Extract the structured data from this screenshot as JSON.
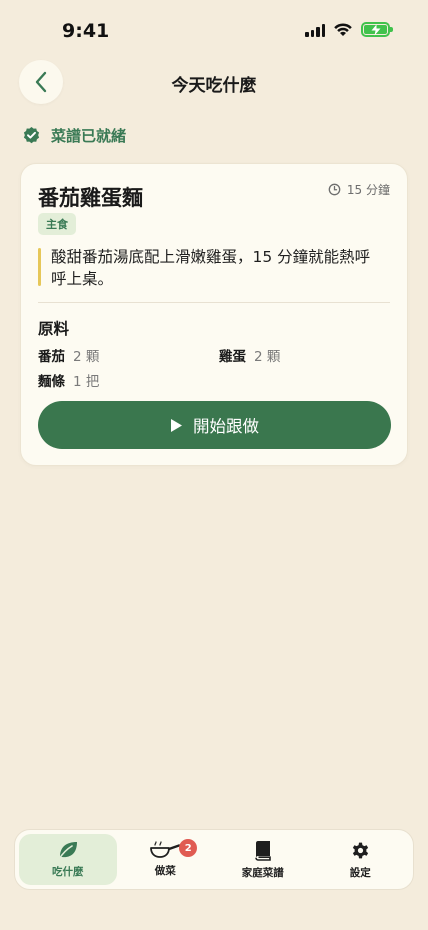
{
  "status_bar": {
    "time": "9:41"
  },
  "header": {
    "title": "今天吃什麼"
  },
  "status": {
    "label": "菜譜已就緒"
  },
  "recipe": {
    "title": "番茄雞蛋麵",
    "duration": "15 分鐘",
    "tag": "主食",
    "description": "酸甜番茄湯底配上滑嫩雞蛋，15 分鐘就能熱呼呼上桌。",
    "ingredients_heading": "原料",
    "ingredients": [
      {
        "name": "番茄",
        "qty": "2 顆"
      },
      {
        "name": "雞蛋",
        "qty": "2 顆"
      },
      {
        "name": "麵條",
        "qty": "1 把"
      }
    ],
    "start_label": "開始跟做"
  },
  "tabs": [
    {
      "label": "吃什麼",
      "icon": "leaf-icon",
      "active": true
    },
    {
      "label": "做菜",
      "icon": "pan-icon",
      "badge": "2"
    },
    {
      "label": "家庭菜譜",
      "icon": "book-icon"
    },
    {
      "label": "設定",
      "icon": "gear-icon"
    }
  ],
  "colors": {
    "background": "#f4ecdc",
    "accent": "#3a774e",
    "tag_bg": "#e3eed8",
    "highlight": "#e6c759",
    "badge": "#e05b52",
    "battery": "#41c24c"
  }
}
